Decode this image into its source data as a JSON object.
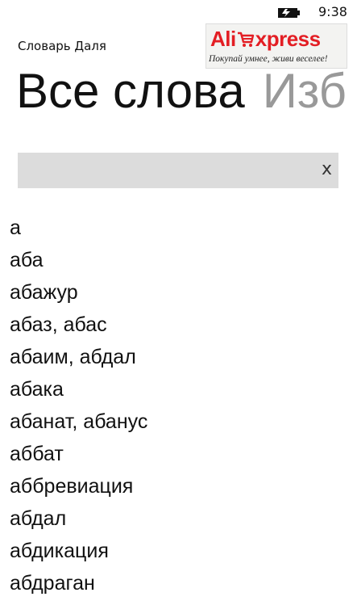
{
  "status_bar": {
    "time": "9:38",
    "battery_icon": "battery-charging-icon"
  },
  "app": {
    "title": "Словарь Даля"
  },
  "ad": {
    "brand_part1": "Ali",
    "brand_part2": "xpress",
    "slogan": "Покупай умнее, живи веселее!",
    "brand_color": "#e31e24",
    "cart_icon": "shopping-cart-icon"
  },
  "pivot": {
    "active_tab": "Все слова",
    "next_tab": "Изб"
  },
  "search": {
    "value": "",
    "placeholder": "",
    "clear_label": "x"
  },
  "words": [
    "а",
    "аба",
    "абажур",
    "абаз, абас",
    "абаим, абдал",
    "абака",
    "абанат, абанус",
    "аббат",
    "аббревиация",
    "абдал",
    "абдикация",
    "абдраган"
  ]
}
